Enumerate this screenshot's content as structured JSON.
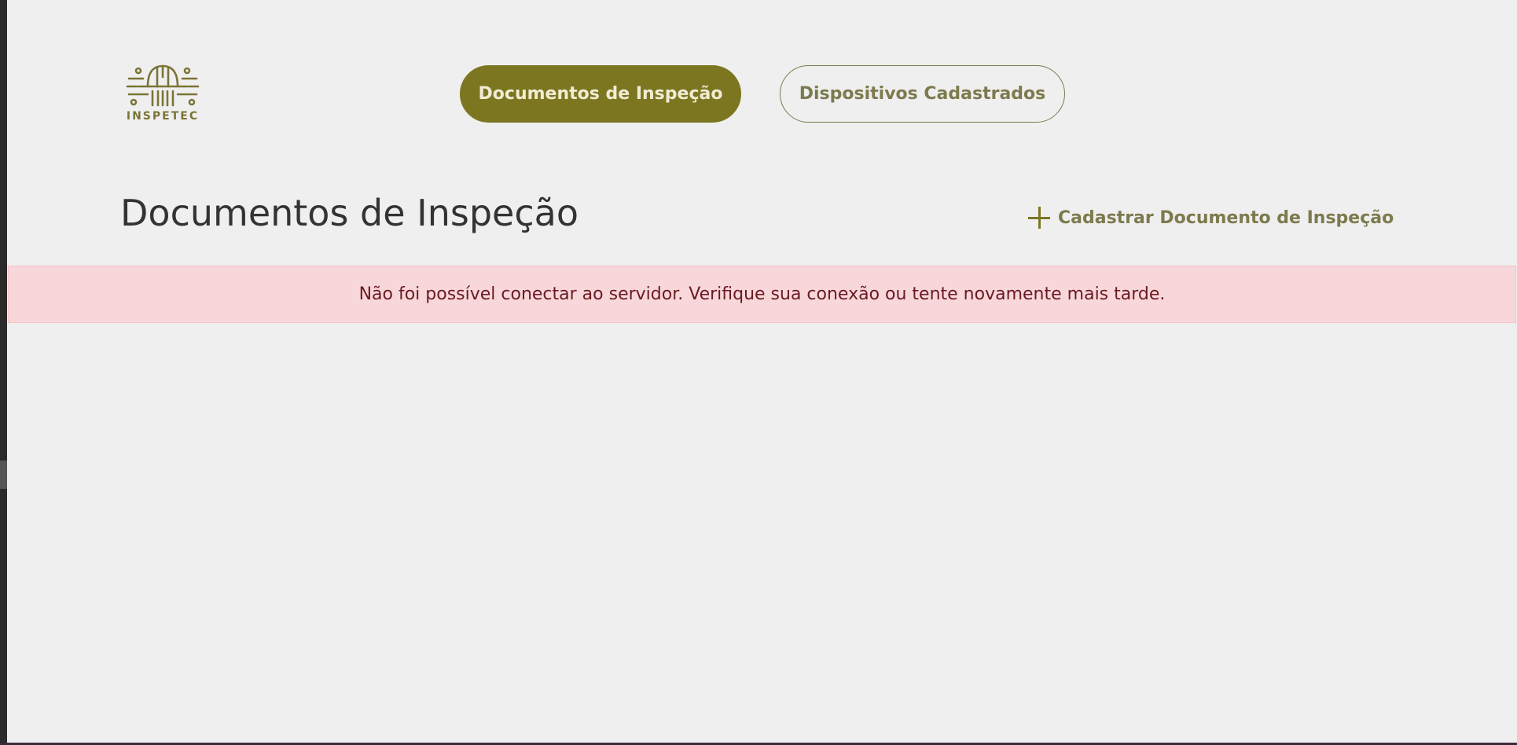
{
  "logo": {
    "text": "INSPETEC",
    "color": "#7a7436"
  },
  "nav": {
    "items": [
      {
        "label": "Documentos de Inspeção",
        "active": true
      },
      {
        "label": "Dispositivos Cadastrados",
        "active": false
      }
    ]
  },
  "page": {
    "title": "Documentos de Inspeção",
    "add_action_label": "Cadastrar Documento de Inspeção"
  },
  "alert": {
    "type": "error",
    "message": "Não foi possível conectar ao servidor. Verifique sua conexão ou tente novamente mais tarde."
  },
  "colors": {
    "background": "#efefef",
    "accent": "#7d7620",
    "accent_muted": "#7d7a4e",
    "alert_bg": "#f8d7da",
    "alert_text": "#6a1a21"
  }
}
